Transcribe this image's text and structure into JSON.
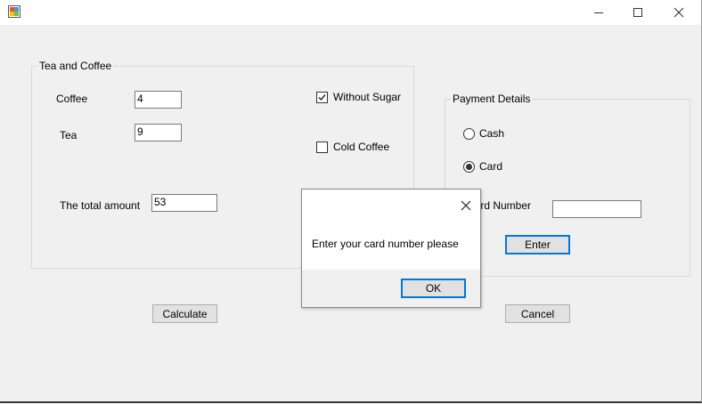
{
  "window": {
    "caption_buttons": [
      "minimize-icon",
      "maximize-icon",
      "close-icon"
    ]
  },
  "tea_coffee": {
    "group_title": "Tea and Coffee",
    "coffee_label": "Coffee",
    "coffee_value": "4",
    "tea_label": "Tea",
    "tea_value": "9",
    "total_label": "The total amount",
    "total_value": "53",
    "without_sugar_label": "Without Sugar",
    "without_sugar_checked": true,
    "cold_coffee_label": "Cold Coffee",
    "cold_coffee_checked": false
  },
  "payment": {
    "group_title": "Payment Details",
    "cash_label": "Cash",
    "card_label": "Card",
    "selected": "Card",
    "card_number_label": "Card Number",
    "card_number_value": "",
    "enter_label": "Enter"
  },
  "buttons": {
    "calculate_label": "Calculate",
    "cancel_label": "Cancel"
  },
  "dialog": {
    "message": "Enter your card number please",
    "ok_label": "OK"
  },
  "colors": {
    "accent": "#0078d7",
    "window_bg": "#f0f0f0"
  }
}
